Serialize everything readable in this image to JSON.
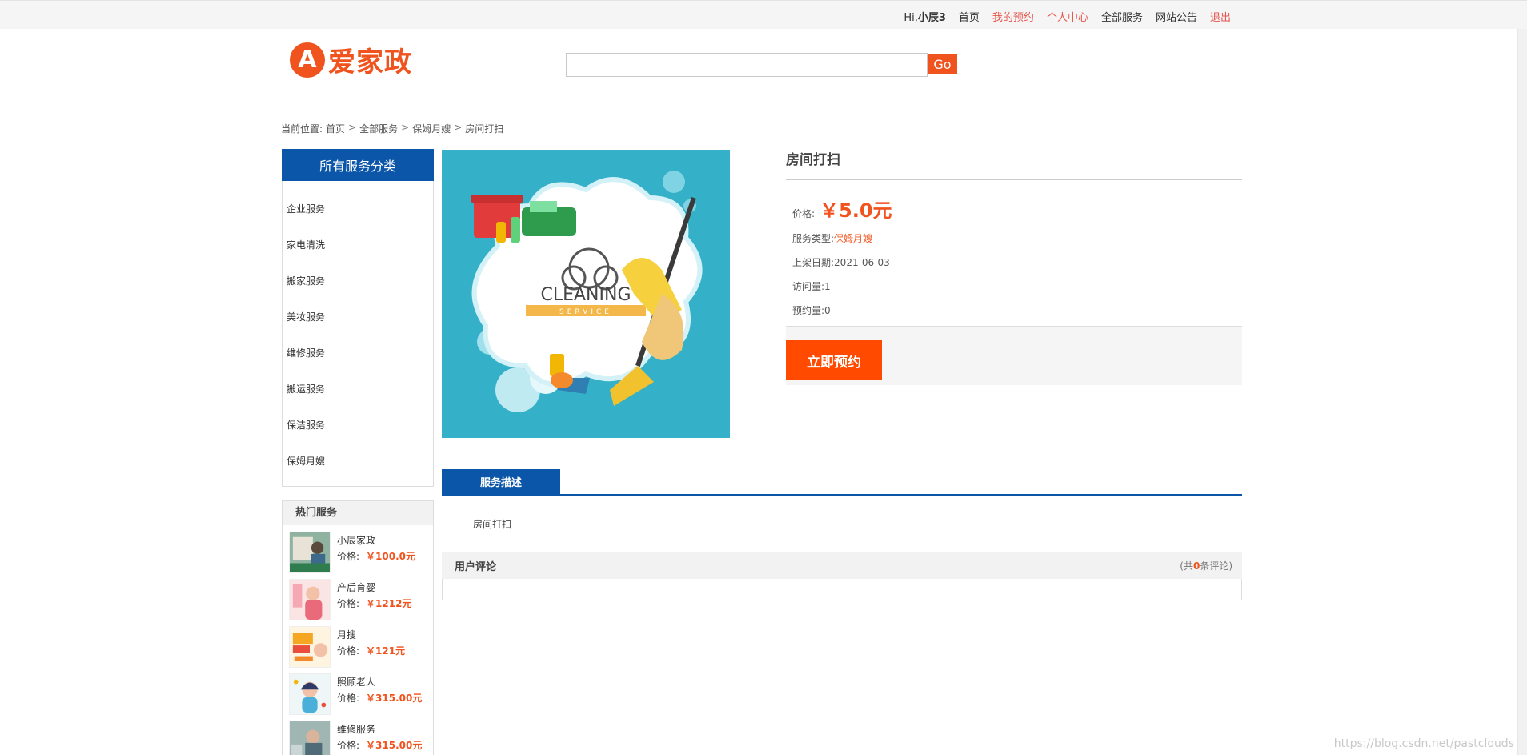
{
  "topbar": {
    "greet_prefix": "Hi,",
    "username": "小辰3",
    "links": [
      "首页",
      "我的预约",
      "个人中心",
      "全部服务",
      "网站公告",
      "退出"
    ]
  },
  "logo": {
    "mark": "A",
    "text": "爱家政"
  },
  "search": {
    "value": "",
    "button": "Go"
  },
  "breadcrumb": {
    "prefix": "当前位置:",
    "items": [
      "首页",
      "全部服务",
      "保姆月嫂",
      "房间打扫"
    ],
    "sep": ">"
  },
  "categories": {
    "title": "所有服务分类",
    "items": [
      "企业服务",
      "家电清洗",
      "搬家服务",
      "美妆服务",
      "维修服务",
      "搬运服务",
      "保洁服务",
      "保姆月嫂"
    ]
  },
  "hot": {
    "title": "热门服务",
    "price_label": "价格:",
    "items": [
      {
        "name": "小辰家政",
        "price": "￥100.0元"
      },
      {
        "name": "产后育婴",
        "price": "￥1212元"
      },
      {
        "name": "月搜",
        "price": "￥121元"
      },
      {
        "name": "照顾老人",
        "price": "￥315.00元"
      },
      {
        "name": "维修服务",
        "price": "￥315.00元"
      }
    ]
  },
  "product": {
    "image_text": "CLEANING",
    "image_subtext": "SERVICE",
    "title": "房间打扫",
    "price_label": "价格:",
    "price": "￥5.0元",
    "type_label": "服务类型:",
    "type": "保姆月嫂",
    "date_label": "上架日期:",
    "date": "2021-06-03",
    "views_label": "访问量:",
    "views": "1",
    "bookings_label": "预约量:",
    "bookings": "0",
    "order_button": "立即预约"
  },
  "tabs": {
    "desc": "服务描述"
  },
  "description": "房间打扫",
  "reviews": {
    "title": "用户评论",
    "count_prefix": "(共",
    "count": "0",
    "count_suffix": "条评论)"
  },
  "watermark": "https://blog.csdn.net/pastclouds",
  "colors": {
    "brand": "#f0531d",
    "blue": "#0b56a8",
    "order": "#ff4a00"
  }
}
